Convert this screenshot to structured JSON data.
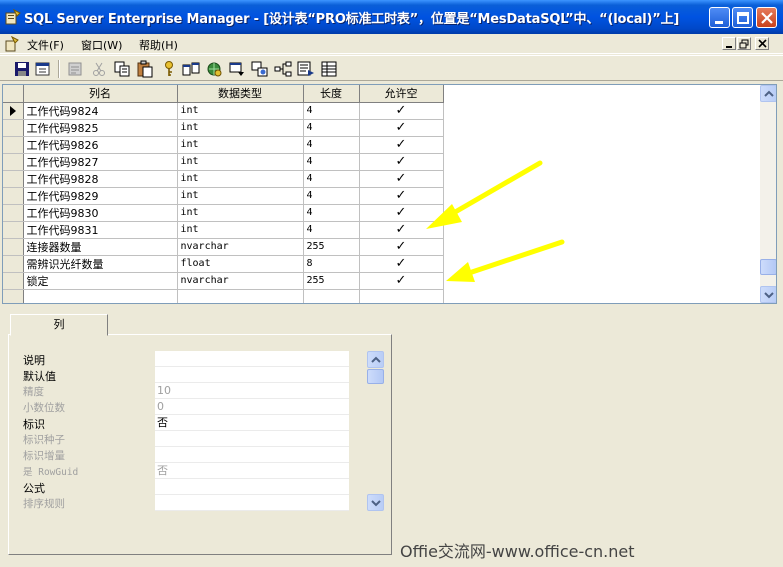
{
  "window": {
    "title": "SQL Server Enterprise Manager - [设计表“PRO标准工时表”，位置是“MesDataSQL”中、“(local)”上]",
    "accent": "#0053e1"
  },
  "menu": {
    "file": "文件(F)",
    "window": "窗口(W)",
    "help": "帮助(H)"
  },
  "toolbar": {
    "icons": [
      "save-icon",
      "properties-icon",
      "cut-icon",
      "copy-icon",
      "paste-icon",
      "primary-key-icon",
      "relationships-icon",
      "indexes-icon",
      "constraints-icon",
      "triggers-icon",
      "dependencies-icon",
      "generate-script-icon",
      "grid-icon"
    ]
  },
  "grid": {
    "headers": {
      "name": "列名",
      "type": "数据类型",
      "length": "长度",
      "nullable": "允许空"
    },
    "rows": [
      {
        "name": "工作代码9824",
        "type": "int",
        "length": "4",
        "nullable": "✓"
      },
      {
        "name": "工作代码9825",
        "type": "int",
        "length": "4",
        "nullable": "✓"
      },
      {
        "name": "工作代码9826",
        "type": "int",
        "length": "4",
        "nullable": "✓"
      },
      {
        "name": "工作代码9827",
        "type": "int",
        "length": "4",
        "nullable": "✓"
      },
      {
        "name": "工作代码9828",
        "type": "int",
        "length": "4",
        "nullable": "✓"
      },
      {
        "name": "工作代码9829",
        "type": "int",
        "length": "4",
        "nullable": "✓"
      },
      {
        "name": "工作代码9830",
        "type": "int",
        "length": "4",
        "nullable": "✓"
      },
      {
        "name": "工作代码9831",
        "type": "int",
        "length": "4",
        "nullable": "✓"
      },
      {
        "name": "连接器数量",
        "type": "nvarchar",
        "length": "255",
        "nullable": "✓"
      },
      {
        "name": "需辨识光纤数量",
        "type": "float",
        "length": "8",
        "nullable": "✓"
      },
      {
        "name": "锁定",
        "type": "nvarchar",
        "length": "255",
        "nullable": "✓"
      },
      {
        "name": "",
        "type": "",
        "length": "",
        "nullable": ""
      }
    ]
  },
  "properties": {
    "tab": "列",
    "rows": [
      {
        "label": "说明",
        "value": "",
        "enabled": true
      },
      {
        "label": "默认值",
        "value": "",
        "enabled": true
      },
      {
        "label": "精度",
        "value": "10",
        "enabled": false
      },
      {
        "label": "小数位数",
        "value": "0",
        "enabled": false
      },
      {
        "label": "标识",
        "value": "否",
        "enabled": true
      },
      {
        "label": "标识种子",
        "value": "",
        "enabled": false
      },
      {
        "label": "标识增量",
        "value": "",
        "enabled": false
      },
      {
        "label": "是 RowGuid",
        "value": "否",
        "enabled": false
      },
      {
        "label": "公式",
        "value": "",
        "enabled": true
      },
      {
        "label": "排序规则",
        "value": "",
        "enabled": false
      }
    ]
  },
  "annotation_color": "#ffff00",
  "watermark": "Offie交流网-www.office-cn.net"
}
